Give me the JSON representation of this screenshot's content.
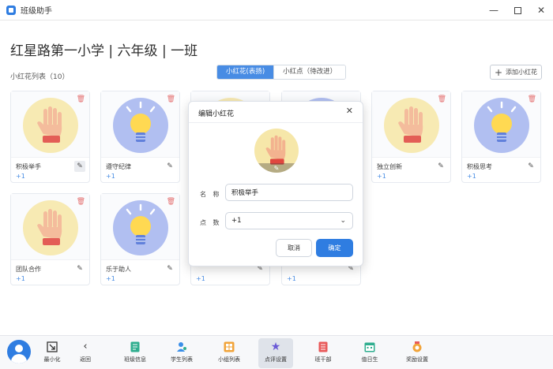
{
  "window": {
    "title": "班级助手",
    "minimize": "—",
    "close": "✕"
  },
  "heading": "红星路第一小学 | 六年级 | 一班",
  "list_label": "小红花列表（10）",
  "segment": {
    "active": "小红花(表扬)",
    "inactive": "小红点（待改进）"
  },
  "add_button": "添加小红花",
  "cards": [
    {
      "name": "积极举手",
      "points": "+1",
      "icon": "hand-icon"
    },
    {
      "name": "遵守纪律",
      "points": "+1",
      "icon": "lightbulb-icon"
    },
    {
      "name": "",
      "points": "",
      "icon": "hand-icon"
    },
    {
      "name": "",
      "points": "",
      "icon": "lightbulb-icon"
    },
    {
      "name": "独立创新",
      "points": "+1",
      "icon": "hand-icon"
    },
    {
      "name": "积极思考",
      "points": "+1",
      "icon": "lightbulb-icon"
    },
    {
      "name": "团队合作",
      "points": "+1",
      "icon": "hand-icon"
    },
    {
      "name": "乐于助人",
      "points": "+1",
      "icon": "lightbulb-icon"
    },
    {
      "name": "",
      "points": "+1",
      "icon": ""
    },
    {
      "name": "",
      "points": "+1",
      "icon": ""
    }
  ],
  "dialog": {
    "title": "编辑小红花",
    "close": "✕",
    "name_label": "名 称",
    "name_value": "积极举手",
    "points_label": "点 数",
    "points_value": "+1",
    "cancel": "取消",
    "confirm": "确定"
  },
  "toolbar": [
    {
      "label": "最小化",
      "icon": "minimize-icon"
    },
    {
      "label": "返回",
      "icon": "back-arrow-icon"
    },
    {
      "label": "班级信息",
      "icon": "class-info-icon"
    },
    {
      "label": "学生列表",
      "icon": "students-icon"
    },
    {
      "label": "小组列表",
      "icon": "groups-icon"
    },
    {
      "label": "点评设置",
      "icon": "star-icon"
    },
    {
      "label": "班干部",
      "icon": "cadre-icon"
    },
    {
      "label": "值日生",
      "icon": "calendar-icon"
    },
    {
      "label": "奖励设置",
      "icon": "medal-icon"
    }
  ],
  "colors": {
    "accent": "#2f7de1",
    "danger": "#e05b5b",
    "hand_bg": "#f6e7a9",
    "bulb_bg": "#a7b7ef"
  }
}
